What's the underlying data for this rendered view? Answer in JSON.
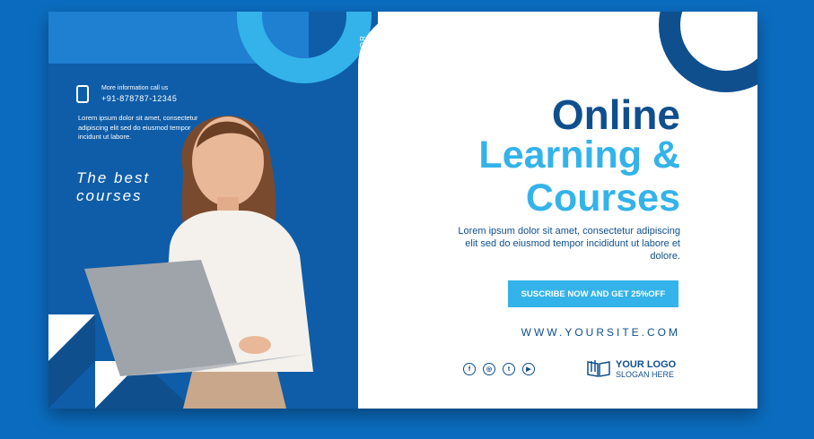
{
  "contact": {
    "caption": "More information call us",
    "phone": "+91-878787-12345",
    "paragraph": "Lorem ipsum dolor sit amet, consectetur adipiscing elit sed do eiusmod tempor incidunt ut labore."
  },
  "tagline": [
    "The best",
    "courses"
  ],
  "vertical_text": "LOREM IPSUM DOLOR",
  "headline": {
    "line1": "Online",
    "line2": "Learning &",
    "line3": "Courses"
  },
  "description": "Lorem ipsum dolor sit amet, consectetur adipiscing elit sed do eiusmod tempor incididunt ut labore et dolore.",
  "cta_label": "SUSCRIBE NOW AND GET 25%OFF",
  "website": "WWW.YOURSITE.COM",
  "socials": [
    {
      "name": "facebook-icon",
      "glyph": "f"
    },
    {
      "name": "instagram-icon",
      "glyph": "◎"
    },
    {
      "name": "twitter-icon",
      "glyph": "t"
    },
    {
      "name": "youtube-icon",
      "glyph": "▶"
    }
  ],
  "logo": {
    "name": "YOUR LOGO",
    "slogan": "SLOGAN HERE"
  },
  "colors": {
    "background": "#0b6cbf",
    "navy": "#0f4f8e",
    "panel_blue": "#0f5da8",
    "cyan": "#33b3ea"
  }
}
